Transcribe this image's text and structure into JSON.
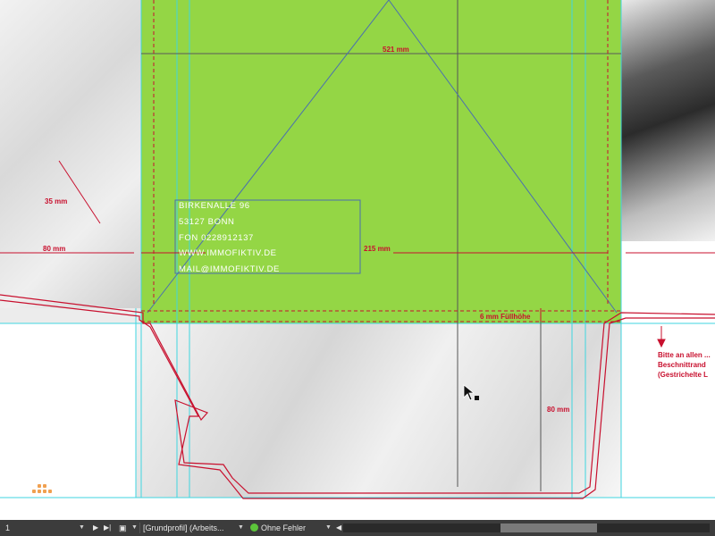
{
  "document": {
    "address_lines": [
      "BIRKENALLE 96",
      "53127 BONN",
      "FON 0228912137",
      "WWW.IMMOFIKTIV.DE",
      "MAIL@IMMOFIKTIV.DE"
    ],
    "dimensions": {
      "top_width": "521 mm",
      "flap_length": "35 mm",
      "left_width": "80 mm",
      "center_width": "215 mm",
      "fill_height": "6 mm Füllhöhe",
      "right_width": "80 mm"
    },
    "note_lines": [
      "Bitte an allen ...",
      "Beschnittrand",
      "(Gestrichelte L"
    ]
  },
  "statusbar": {
    "page_number": "1",
    "profile": "[Grundprofil] (Arbeits...",
    "status": "Ohne Fehler",
    "colors": {
      "ok": "#5cc43a"
    }
  },
  "colors": {
    "green_area": "#94d645",
    "dimension_red": "#c8102e",
    "guide_cyan": "#3fd6e0"
  }
}
